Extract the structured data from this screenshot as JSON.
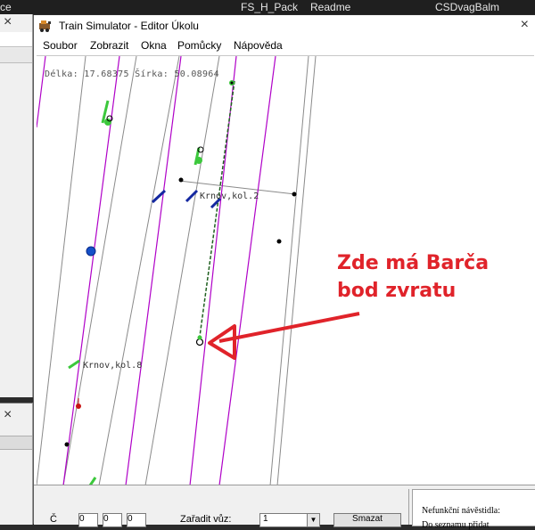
{
  "taskbar": {
    "left_fragment": "ce",
    "items": [
      "FS_H_Pack",
      "Readme",
      "CSDvagBalm"
    ]
  },
  "window": {
    "title": "Train Simulator - Editor Úkolu",
    "close": "×"
  },
  "menu": [
    "Soubor",
    "Zobrazit",
    "Okna",
    "Pomůcky",
    "Nápověda"
  ],
  "map": {
    "coords": "Délka: 17.68375 Šírka: 50.08964",
    "signal_labels": [
      "Krnov,kol.2",
      "Krnov,kol.8"
    ],
    "annotation": [
      "Zde má Barča",
      "bod zvratu"
    ]
  },
  "bottom": {
    "status_label": "Nefunkční návěstidla:",
    "status_label2": "Do seznamu přidat",
    "select_value": "1",
    "fields": [
      "0",
      "0",
      "0"
    ],
    "left_label": "Č",
    "mid_label": "Zařadit vůz:",
    "right_button": "Smazat"
  },
  "colors": {
    "track_magenta": "#b000c8",
    "track_gray": "#8a8a8a",
    "signal_green": "#3cc83c",
    "signal_blue": "#1428a0",
    "annotation_red": "#e0232a"
  }
}
